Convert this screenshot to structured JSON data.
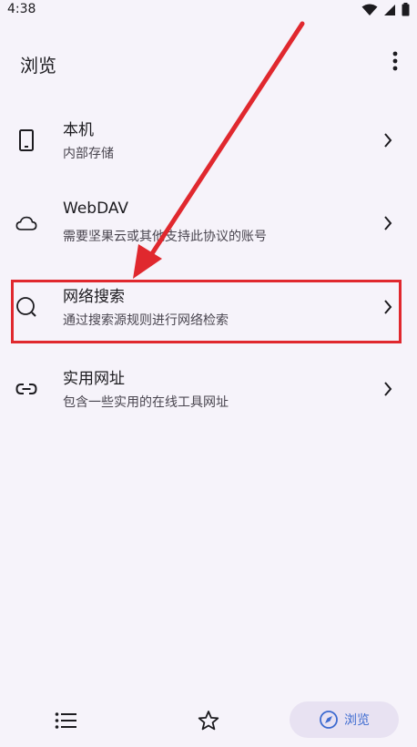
{
  "status": {
    "time": "4:38"
  },
  "header": {
    "title": "浏览"
  },
  "items": [
    {
      "title": "本机",
      "subtitle": "内部存储",
      "icon": "phone-icon"
    },
    {
      "title": "WebDAV",
      "subtitle": "需要坚果云或其他支持此协议的账号",
      "icon": "cloud-icon"
    },
    {
      "title": "网络搜索",
      "subtitle": "通过搜索源规则进行网络检索",
      "icon": "search-icon"
    },
    {
      "title": "实用网址",
      "subtitle": "包含一些实用的在线工具网址",
      "icon": "link-icon"
    }
  ],
  "bottom_nav": {
    "active_label": "浏览"
  },
  "colors": {
    "background": "#f6f3fa",
    "highlight": "#e0282e",
    "accent": "#3d6bd0"
  }
}
